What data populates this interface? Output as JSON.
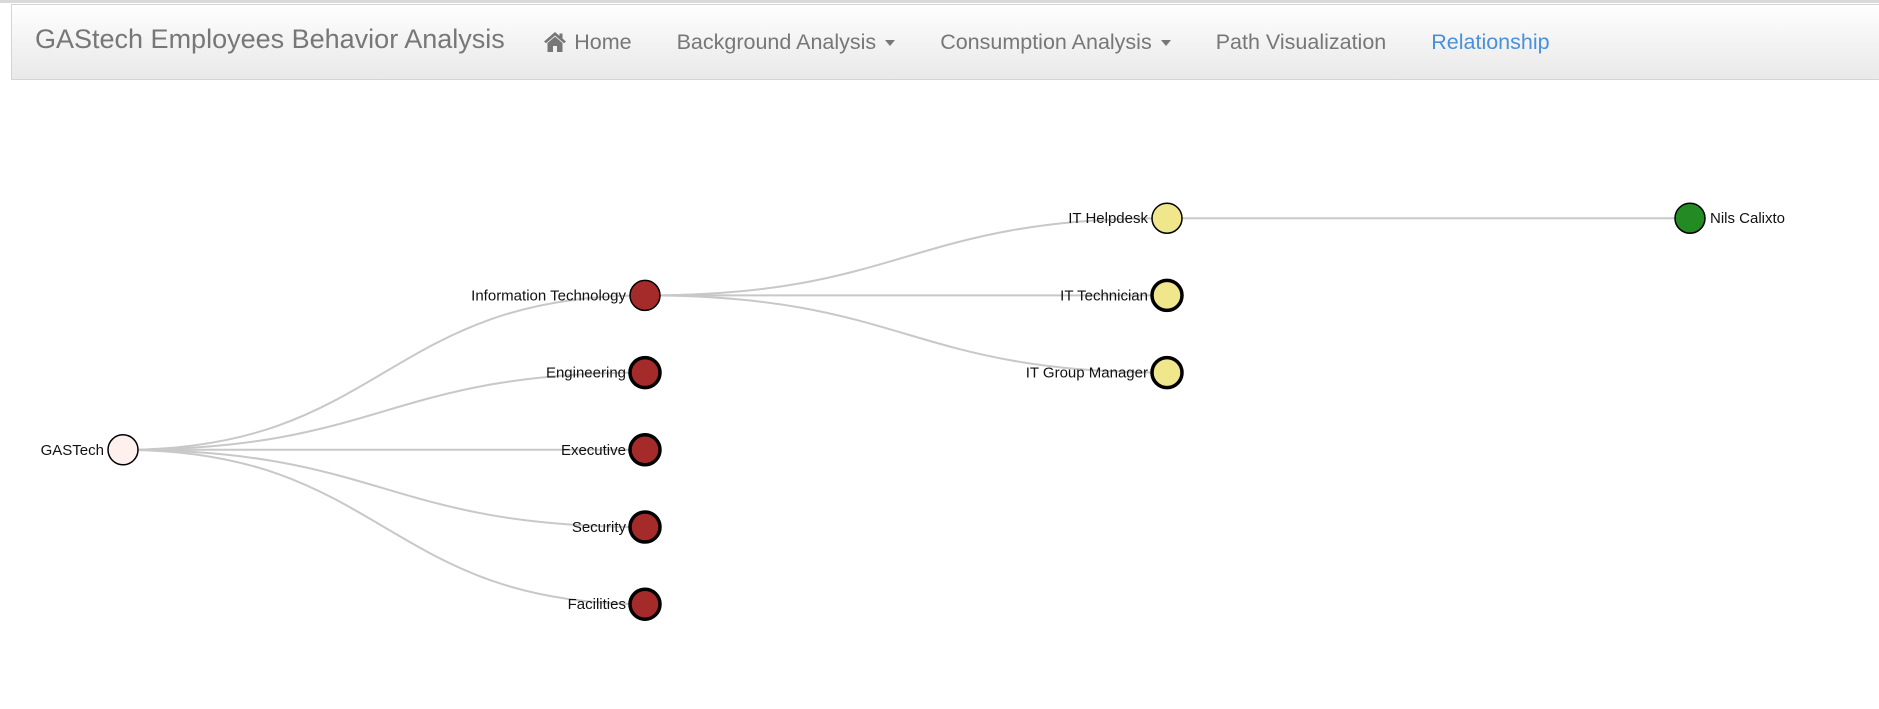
{
  "navbar": {
    "brand": "GAStech Employees Behavior Analysis",
    "items": [
      {
        "label": "Home",
        "icon": "home-icon",
        "active": false,
        "dropdown": false
      },
      {
        "label": "Background Analysis",
        "active": false,
        "dropdown": true
      },
      {
        "label": "Consumption Analysis",
        "active": false,
        "dropdown": true
      },
      {
        "label": "Path Visualization",
        "active": false,
        "dropdown": false
      },
      {
        "label": "Relationship",
        "active": true,
        "dropdown": false
      }
    ],
    "active_color": "#4a90d9",
    "text_color": "#777777"
  },
  "tree": {
    "root": {
      "name": "GASTech",
      "collapsed": false,
      "children": [
        {
          "name": "Information Technology",
          "collapsed": false,
          "children": [
            {
              "name": "IT Helpdesk",
              "collapsed": false,
              "children": [
                {
                  "name": "Nils Calixto",
                  "leaf": true
                }
              ]
            },
            {
              "name": "IT Technician",
              "collapsed": true
            },
            {
              "name": "IT Group Manager",
              "collapsed": true
            }
          ]
        },
        {
          "name": "Engineering",
          "collapsed": true
        },
        {
          "name": "Executive",
          "collapsed": true
        },
        {
          "name": "Security",
          "collapsed": true
        },
        {
          "name": "Facilities",
          "collapsed": true
        }
      ]
    },
    "level_colors": [
      "#fdf0ed",
      "#a52a2a",
      "#f0e68c",
      "#228b22"
    ],
    "link_color": "#c8c8c8"
  }
}
